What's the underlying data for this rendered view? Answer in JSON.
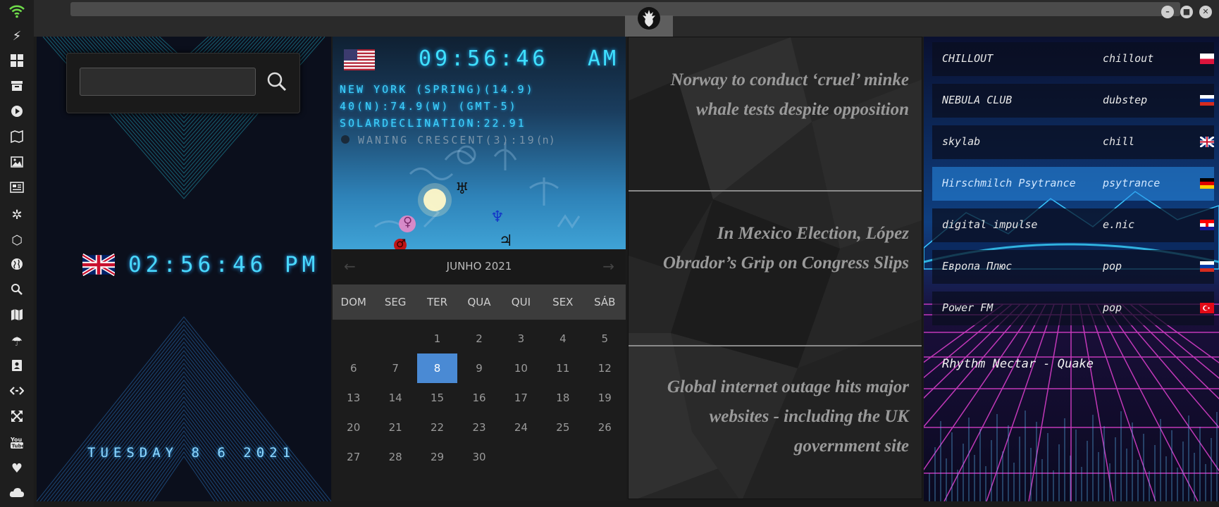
{
  "window": {
    "controls": {
      "minimize": "–",
      "maximize": "■",
      "close": "✕"
    }
  },
  "rail": {
    "icons": [
      "wifi-icon",
      "bolt-icon",
      "windows-icon",
      "archive-icon",
      "play-icon",
      "map-book-icon",
      "image-icon",
      "news-icon",
      "settings-icon",
      "hexagon-icon",
      "globe-icon",
      "search-icon",
      "map-icon",
      "umbrella-icon",
      "contacts-icon",
      "code-icon",
      "expand-icon",
      "youtube-icon",
      "heart-icon",
      "cloud-icon"
    ]
  },
  "clock": {
    "search_placeholder": "",
    "time": "02:56:46 PM",
    "date": "TUESDAY 8 6 2021"
  },
  "astro": {
    "time": "09:56:46",
    "ampm": "AM",
    "line1": "NEW YORK (SPRING)(14.9)",
    "line2": "40(N):74.9(W) (GMT-5)",
    "line3": "SOLARDECLINATION:22.91",
    "moon": "WANING CRESCENT(3):19",
    "moon_suffix": "(n)",
    "planets": {
      "uranus": "♅",
      "neptune": "♆",
      "jupiter": "♃",
      "venus": "♀",
      "mars": "♂"
    }
  },
  "calendar": {
    "prev": "←",
    "next": "→",
    "month": "JUNHO 2021",
    "weekdays": [
      "DOM",
      "SEG",
      "TER",
      "QUA",
      "QUI",
      "SEX",
      "SÁB"
    ],
    "leading_blanks": 2,
    "days": [
      "1",
      "2",
      "3",
      "4",
      "5",
      "6",
      "7",
      "8",
      "9",
      "10",
      "11",
      "12",
      "13",
      "14",
      "15",
      "16",
      "17",
      "18",
      "19",
      "20",
      "21",
      "22",
      "23",
      "24",
      "25",
      "26",
      "27",
      "28",
      "29",
      "30"
    ],
    "selected": "8"
  },
  "news": {
    "items": [
      "Norway to conduct ‘cruel’ minke whale tests despite opposition",
      "In Mexico Election, López Obrador’s Grip on Congress Slips",
      "Global internet outage hits major websites - including the UK government site"
    ]
  },
  "radio": {
    "stations": [
      {
        "name": "CHILLOUT",
        "genre": "chillout",
        "flag": "poland"
      },
      {
        "name": "NEBULA CLUB",
        "genre": "dubstep",
        "flag": "russia"
      },
      {
        "name": "skylab",
        "genre": "chill",
        "flag": "uk"
      },
      {
        "name": "Hirschmilch Psytrance",
        "genre": "psytrance",
        "flag": "germany",
        "active": true
      },
      {
        "name": "digital impulse",
        "genre": "e.nic",
        "flag": "croatia"
      },
      {
        "name": "Европа Плюс",
        "genre": "pop",
        "flag": "russia"
      },
      {
        "name": "Power FM",
        "genre": "pop",
        "flag": "turkey"
      }
    ],
    "now_playing": "Rhythm Nectar - Quake"
  },
  "colors": {
    "clock_cyan": "#49d8ff",
    "calendar_selected": "#4a8ad4",
    "wifi_green": "#6fdc4a"
  }
}
